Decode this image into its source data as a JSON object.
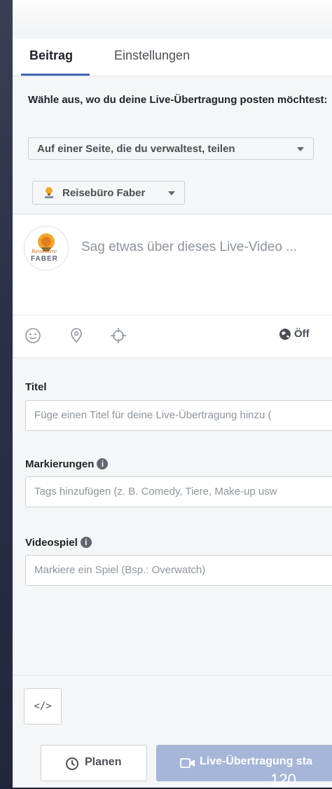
{
  "tabs": [
    {
      "label": "Beitrag",
      "active": true
    },
    {
      "label": "Einstellungen",
      "active": false
    }
  ],
  "prompt": "Wähle aus, wo du deine Live-Übertragung posten möchtest:",
  "destination": {
    "selected": "Auf einer Seite, die du verwaltest, teilen"
  },
  "page_selector": {
    "selected": "Reisebüro Faber"
  },
  "composer": {
    "placeholder": "Sag etwas über dieses Live-Video ...",
    "avatar_text": "FABER",
    "avatar_small": "Reisebüro",
    "audience": "Öff",
    "icons": [
      "emoji-icon",
      "location-pin-icon",
      "target-icon",
      "globe-icon"
    ]
  },
  "fields": {
    "title": {
      "label": "Titel",
      "placeholder": "Füge einen Titel für deine Live-Übertragung hinzu ("
    },
    "tags": {
      "label": "Markierungen",
      "placeholder": "Tags hinzufügen (z. B. Comedy, Tiere, Make-up usw"
    },
    "game": {
      "label": "Videospiel",
      "placeholder": "Markiere ein Spiel (Bsp.: Overwatch)"
    }
  },
  "footer": {
    "embed_label": "</>",
    "plan_label": "Planen",
    "live_label": "Live-Übertragung sta"
  },
  "page_number": "120",
  "colors": {
    "accent": "#4267b2",
    "live_button_disabled": "#a6b6d8",
    "panel_bg": "#f5f6f7"
  }
}
